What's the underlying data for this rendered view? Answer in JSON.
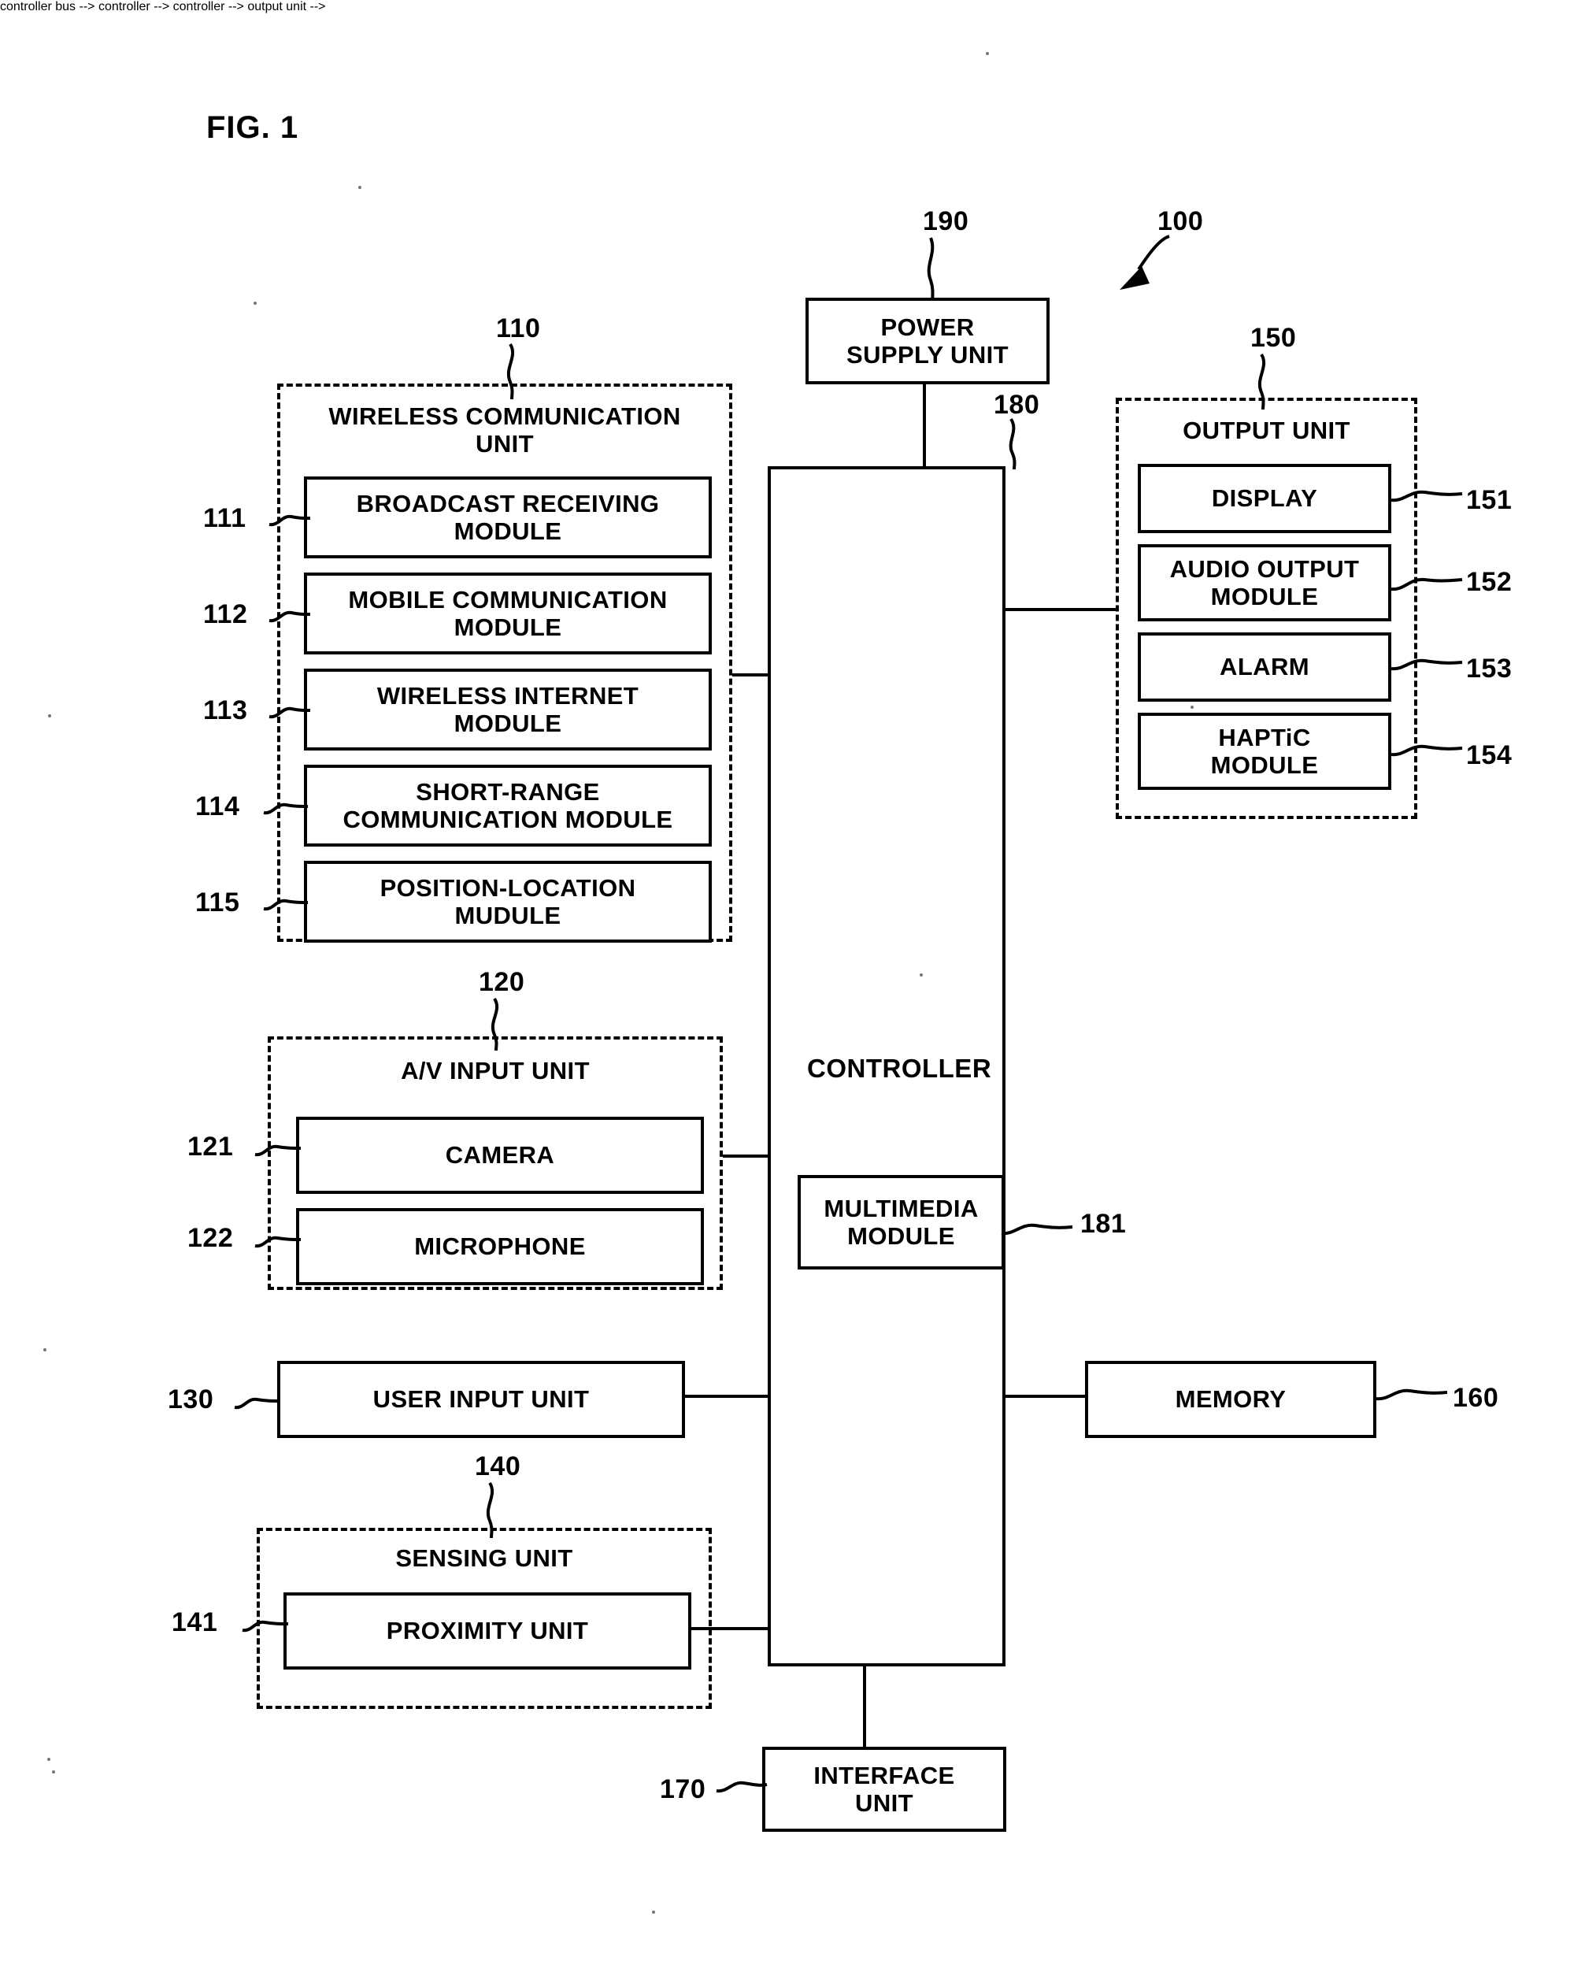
{
  "figure": {
    "title": "FIG. 1",
    "device_ref": "100"
  },
  "blocks": {
    "power_supply": {
      "label": "POWER\nSUPPLY UNIT",
      "ref": "190"
    },
    "controller": {
      "label": "CONTROLLER",
      "ref": "180"
    },
    "multimedia": {
      "label": "MULTIMEDIA\nMODULE",
      "ref": "181"
    },
    "user_input": {
      "label": "USER INPUT UNIT",
      "ref": "130"
    },
    "memory": {
      "label": "MEMORY",
      "ref": "160"
    },
    "interface": {
      "label": "INTERFACE\nUNIT",
      "ref": "170"
    }
  },
  "wireless_unit": {
    "title": "WIRELESS COMMUNICATION\nUNIT",
    "ref": "110",
    "modules": [
      {
        "ref": "111",
        "label": "BROADCAST RECEIVING\nMODULE"
      },
      {
        "ref": "112",
        "label": "MOBILE COMMUNICATION\nMODULE"
      },
      {
        "ref": "113",
        "label": "WIRELESS INTERNET\nMODULE"
      },
      {
        "ref": "114",
        "label": "SHORT-RANGE\nCOMMUNICATION MODULE"
      },
      {
        "ref": "115",
        "label": "POSITION-LOCATION\nMUDULE"
      }
    ]
  },
  "av_input_unit": {
    "title": "A/V INPUT UNIT",
    "ref": "120",
    "modules": [
      {
        "ref": "121",
        "label": "CAMERA"
      },
      {
        "ref": "122",
        "label": "MICROPHONE"
      }
    ]
  },
  "sensing_unit": {
    "title": "SENSING UNIT",
    "ref": "140",
    "modules": [
      {
        "ref": "141",
        "label": "PROXIMITY UNIT"
      }
    ]
  },
  "output_unit": {
    "title": "OUTPUT UNIT",
    "ref": "150",
    "modules": [
      {
        "ref": "151",
        "label": "DISPLAY"
      },
      {
        "ref": "152",
        "label": "AUDIO OUTPUT\nMODULE"
      },
      {
        "ref": "153",
        "label": "ALARM"
      },
      {
        "ref": "154",
        "label": "HAPTiC\nMODULE"
      }
    ]
  },
  "colors": {
    "ink": "#000000",
    "paper": "#ffffff"
  }
}
